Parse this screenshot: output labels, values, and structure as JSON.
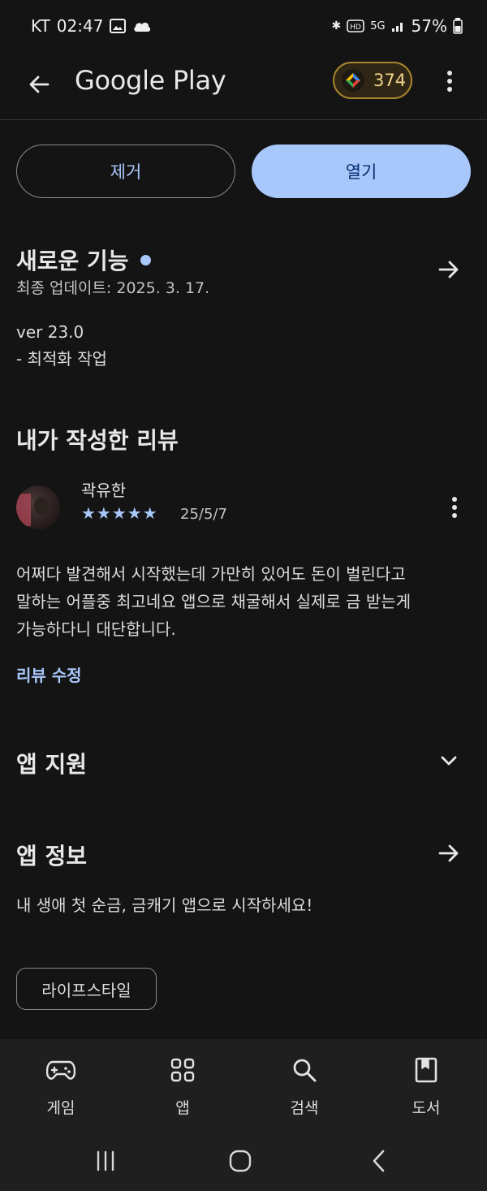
{
  "status_bar": {
    "carrier": "KT",
    "time": "02:47",
    "network": "5G",
    "battery": "57%"
  },
  "app_bar": {
    "brand": "Google Play",
    "points": "374"
  },
  "actions": {
    "remove_label": "제거",
    "open_label": "열기"
  },
  "whats_new": {
    "title": "새로운 기능",
    "updated": "최종 업데이트: 2025. 3. 17.",
    "version": "ver 23.0",
    "notes": "- 최적화 작업"
  },
  "my_review": {
    "title": "내가 작성한 리뷰",
    "author": "곽유한",
    "rating": 5,
    "stars": "★★★★★",
    "date": "25/5/7",
    "line1": "어쩌다 발견해서 시작했는데 가만히 있어도 돈이 벌린다고",
    "line2": "말하는 어플중 최고네요 앱으로 채굴해서 실제로 금 받는게",
    "line3": "가능하다니 대단합니다.",
    "edit_link": "리뷰 수정"
  },
  "app_support": {
    "title": "앱 지원"
  },
  "app_info": {
    "title": "앱 정보",
    "description": "내 생애 첫 순금, 금캐기 앱으로 시작하세요!",
    "category_chip": "라이프스타일"
  },
  "bottom_nav": {
    "items": [
      {
        "label": "게임",
        "icon": "gamepad-icon"
      },
      {
        "label": "앱",
        "icon": "apps-grid-icon"
      },
      {
        "label": "검색",
        "icon": "search-icon"
      },
      {
        "label": "도서",
        "icon": "book-icon"
      }
    ]
  },
  "colors": {
    "background": "#141414",
    "accent": "#a8c7fa",
    "points_border": "#a8862c"
  }
}
